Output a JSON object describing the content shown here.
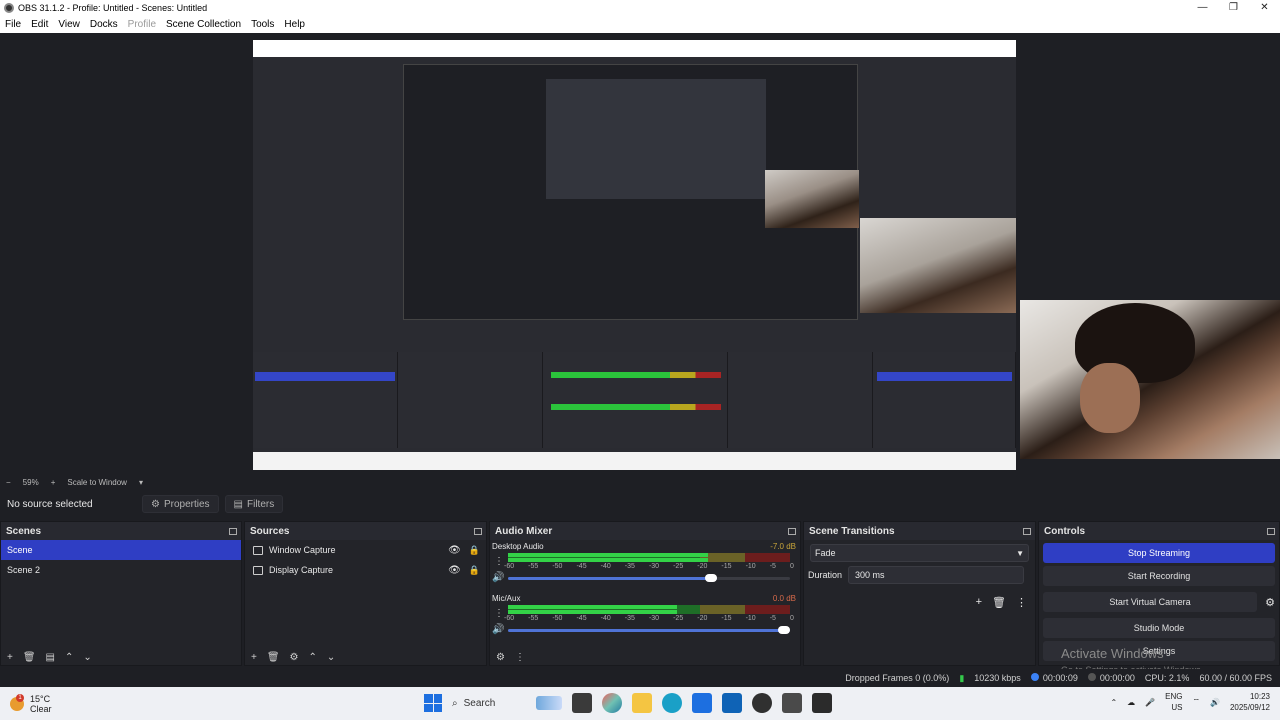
{
  "window": {
    "title": "OBS 31.1.2 - Profile: Untitled - Scenes: Untitled",
    "controls": [
      "—",
      "❐",
      "✕"
    ]
  },
  "menu": {
    "items": [
      "File",
      "Edit",
      "View",
      "Docks",
      "Profile",
      "Scene Collection",
      "Tools",
      "Help"
    ]
  },
  "canvas_bar": {
    "zoom": "59%",
    "scale_mode": "Scale to Window"
  },
  "source_bar": {
    "no_source": "No source selected",
    "properties": "Properties",
    "filters": "Filters"
  },
  "scenes": {
    "title": "Scenes",
    "items": [
      "Scene",
      "Scene 2"
    ]
  },
  "sources": {
    "title": "Sources",
    "items": [
      "Window Capture",
      "Display Capture"
    ]
  },
  "mixer": {
    "title": "Audio Mixer",
    "channels": [
      {
        "name": "Desktop Audio",
        "db": "-7.0 dB",
        "level": 0.71,
        "volume": 0.74
      },
      {
        "name": "Mic/Aux",
        "db": "0.0 dB",
        "level": 0.6,
        "volume": 1.0
      }
    ],
    "ticks": [
      "-60",
      "-55",
      "-50",
      "-45",
      "-40",
      "-35",
      "-30",
      "-25",
      "-20",
      "-15",
      "-10",
      "-5",
      "0"
    ]
  },
  "transitions": {
    "title": "Scene Transitions",
    "selected": "Fade",
    "duration_label": "Duration",
    "duration_value": "300 ms"
  },
  "controls": {
    "title": "Controls",
    "stop_streaming": "Stop Streaming",
    "start_recording": "Start Recording",
    "start_virtual_camera": "Start Virtual Camera",
    "studio_mode": "Studio Mode",
    "settings": "Settings",
    "watermark_title": "Activate Windows",
    "watermark_sub": "Go to Settings to activate Windows."
  },
  "status": {
    "dropped_frames": "Dropped Frames 0 (0.0%)",
    "bitrate": "10230 kbps",
    "stream_time": "00:00:09",
    "record_time": "00:00:00",
    "cpu": "CPU: 2.1%",
    "fps": "60.00 / 60.00 FPS"
  },
  "taskbar": {
    "temperature": "15°C",
    "weather": "Clear",
    "weather_badge": "1",
    "search": "Search",
    "lang_top": "ENG",
    "lang_bottom": "US",
    "time": "10:23",
    "date": "2025/09/12"
  },
  "colors": {
    "accent": "#2f3ec4",
    "meter_green": "#33d247",
    "background": "#1e1f24"
  }
}
